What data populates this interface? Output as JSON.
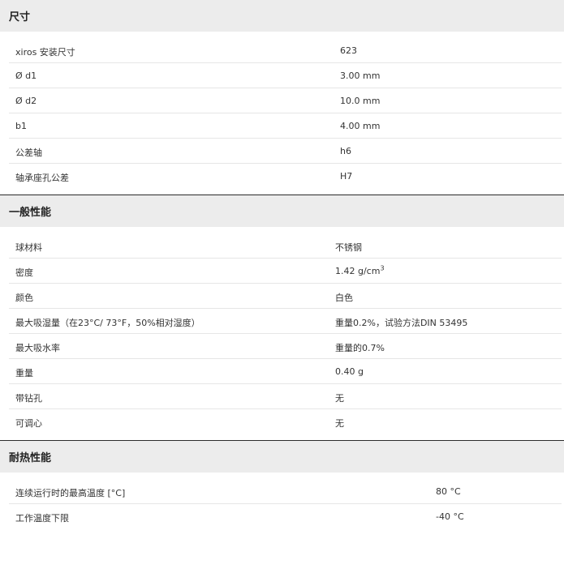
{
  "sections": [
    {
      "title": "尺寸",
      "rows": [
        {
          "label": "xiros 安装尺寸",
          "value": "623"
        },
        {
          "label": "Ø d1",
          "value": "3.00 mm"
        },
        {
          "label": "Ø d2",
          "value": "10.0 mm"
        },
        {
          "label": "b1",
          "value": "4.00 mm"
        },
        {
          "label": "公差轴",
          "value": "h6"
        },
        {
          "label": "轴承座孔公差",
          "value": "H7"
        }
      ]
    },
    {
      "title": "一般性能",
      "rows": [
        {
          "label": "球材料",
          "value": "不锈钢"
        },
        {
          "label": "密度",
          "value": "1.42 g/cm",
          "value_sup": "3"
        },
        {
          "label": "颜色",
          "value": "白色"
        },
        {
          "label": "最大吸湿量（在23°C/ 73°F，50%相对湿度）",
          "value": "重量0.2%，试验方法DIN 53495"
        },
        {
          "label": "最大吸水率",
          "value": "重量的0.7%"
        },
        {
          "label": "重量",
          "value": "0.40 g"
        },
        {
          "label": "带钻孔",
          "value": "无"
        },
        {
          "label": "可调心",
          "value": "无"
        }
      ]
    },
    {
      "title": "耐热性能",
      "rows": [
        {
          "label": "连续运行时的最高温度 [°C]",
          "value": "80 °C"
        },
        {
          "label": "工作温度下限",
          "value": "-40 °C"
        }
      ]
    }
  ]
}
